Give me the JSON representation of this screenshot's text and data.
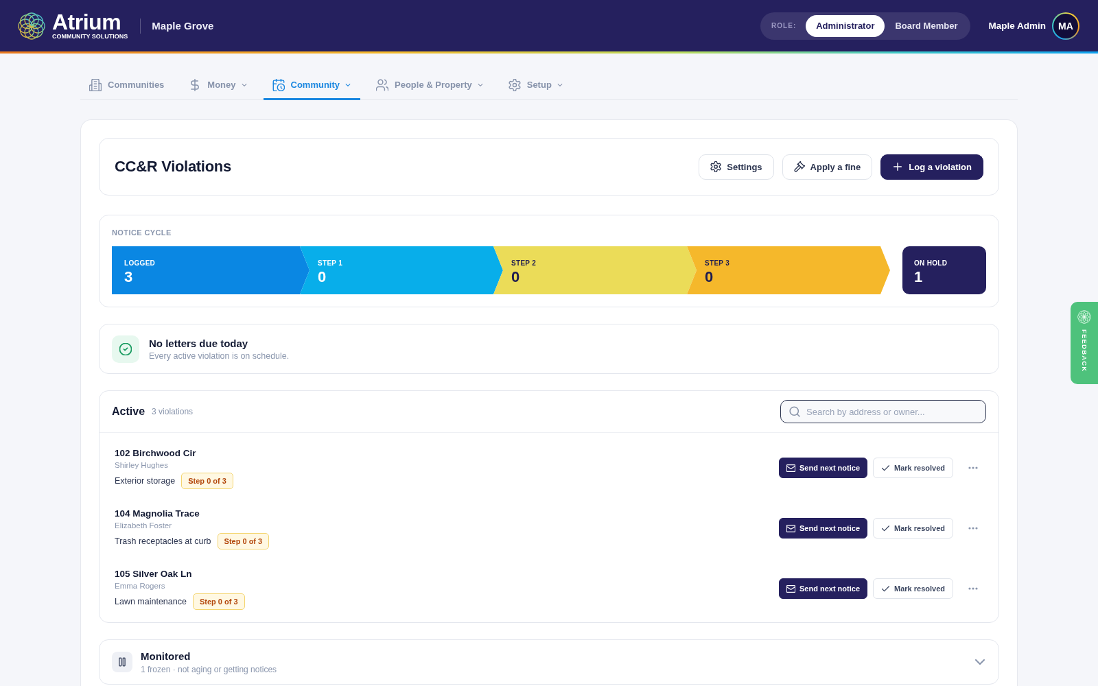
{
  "header": {
    "brand": {
      "name": "Atrium",
      "tagline": "COMMUNITY SOLUTIONS"
    },
    "community": "Maple Grove",
    "role_switch": {
      "label": "ROLE:",
      "options": [
        {
          "label": "Administrator",
          "selected": true
        },
        {
          "label": "Board Member",
          "selected": false
        }
      ]
    },
    "user": {
      "name": "Maple Admin",
      "initials": "MA"
    }
  },
  "nav_tabs": [
    {
      "label": "Communities",
      "dropdown": false,
      "selected": false
    },
    {
      "label": "Money",
      "dropdown": true,
      "selected": false
    },
    {
      "label": "Community",
      "dropdown": true,
      "selected": true
    },
    {
      "label": "People & Property",
      "dropdown": true,
      "selected": false
    },
    {
      "label": "Setup",
      "dropdown": true,
      "selected": false
    }
  ],
  "page_header": {
    "title": "CC&R Violations",
    "buttons": [
      {
        "label": "Settings",
        "kind": "secondary"
      },
      {
        "label": "Apply a fine",
        "kind": "secondary"
      },
      {
        "label": "Log a violation",
        "kind": "primary"
      }
    ]
  },
  "notice_cycle": {
    "title": "NOTICE CYCLE",
    "stages": [
      {
        "label": "LOGGED",
        "count": "3",
        "color": "#0a87e3"
      },
      {
        "label": "STEP 1",
        "count": "0",
        "color": "#08aeea"
      },
      {
        "label": "STEP 2",
        "count": "0",
        "color": "#ebdc58"
      },
      {
        "label": "STEP 3",
        "count": "0",
        "color": "#f5b82b"
      }
    ],
    "on_hold": {
      "label": "ON HOLD",
      "count": "1"
    }
  },
  "status_banner": {
    "title": "No letters due today",
    "subtitle": "Every active violation is on schedule."
  },
  "active": {
    "title": "Active",
    "count": "3 violations",
    "search": {
      "placeholder": "Search by address or owner..."
    },
    "rows": [
      {
        "address": "102 Birchwood Cir",
        "owner": "Shirley Hughes",
        "violation": "Exterior storage",
        "step": "Step 0 of 3",
        "actions": [
          {
            "label": "Send next notice",
            "kind": "primary"
          },
          {
            "label": "Mark resolved",
            "kind": "secondary"
          }
        ]
      },
      {
        "address": "104 Magnolia Trace",
        "owner": "Elizabeth Foster",
        "violation": "Trash receptacles at curb",
        "step": "Step 0 of 3",
        "actions": [
          {
            "label": "Send next notice",
            "kind": "primary"
          },
          {
            "label": "Mark resolved",
            "kind": "secondary"
          }
        ]
      },
      {
        "address": "105 Silver Oak Ln",
        "owner": "Emma Rogers",
        "violation": "Lawn maintenance",
        "step": "Step 0 of 3",
        "actions": [
          {
            "label": "Send next notice",
            "kind": "primary"
          },
          {
            "label": "Mark resolved",
            "kind": "secondary"
          }
        ]
      }
    ]
  },
  "monitored": {
    "title": "Monitored",
    "subtitle": "1 frozen · not aging or getting notices",
    "expanded": false
  },
  "feedback_tab": {
    "label": "FEEDBACK"
  }
}
